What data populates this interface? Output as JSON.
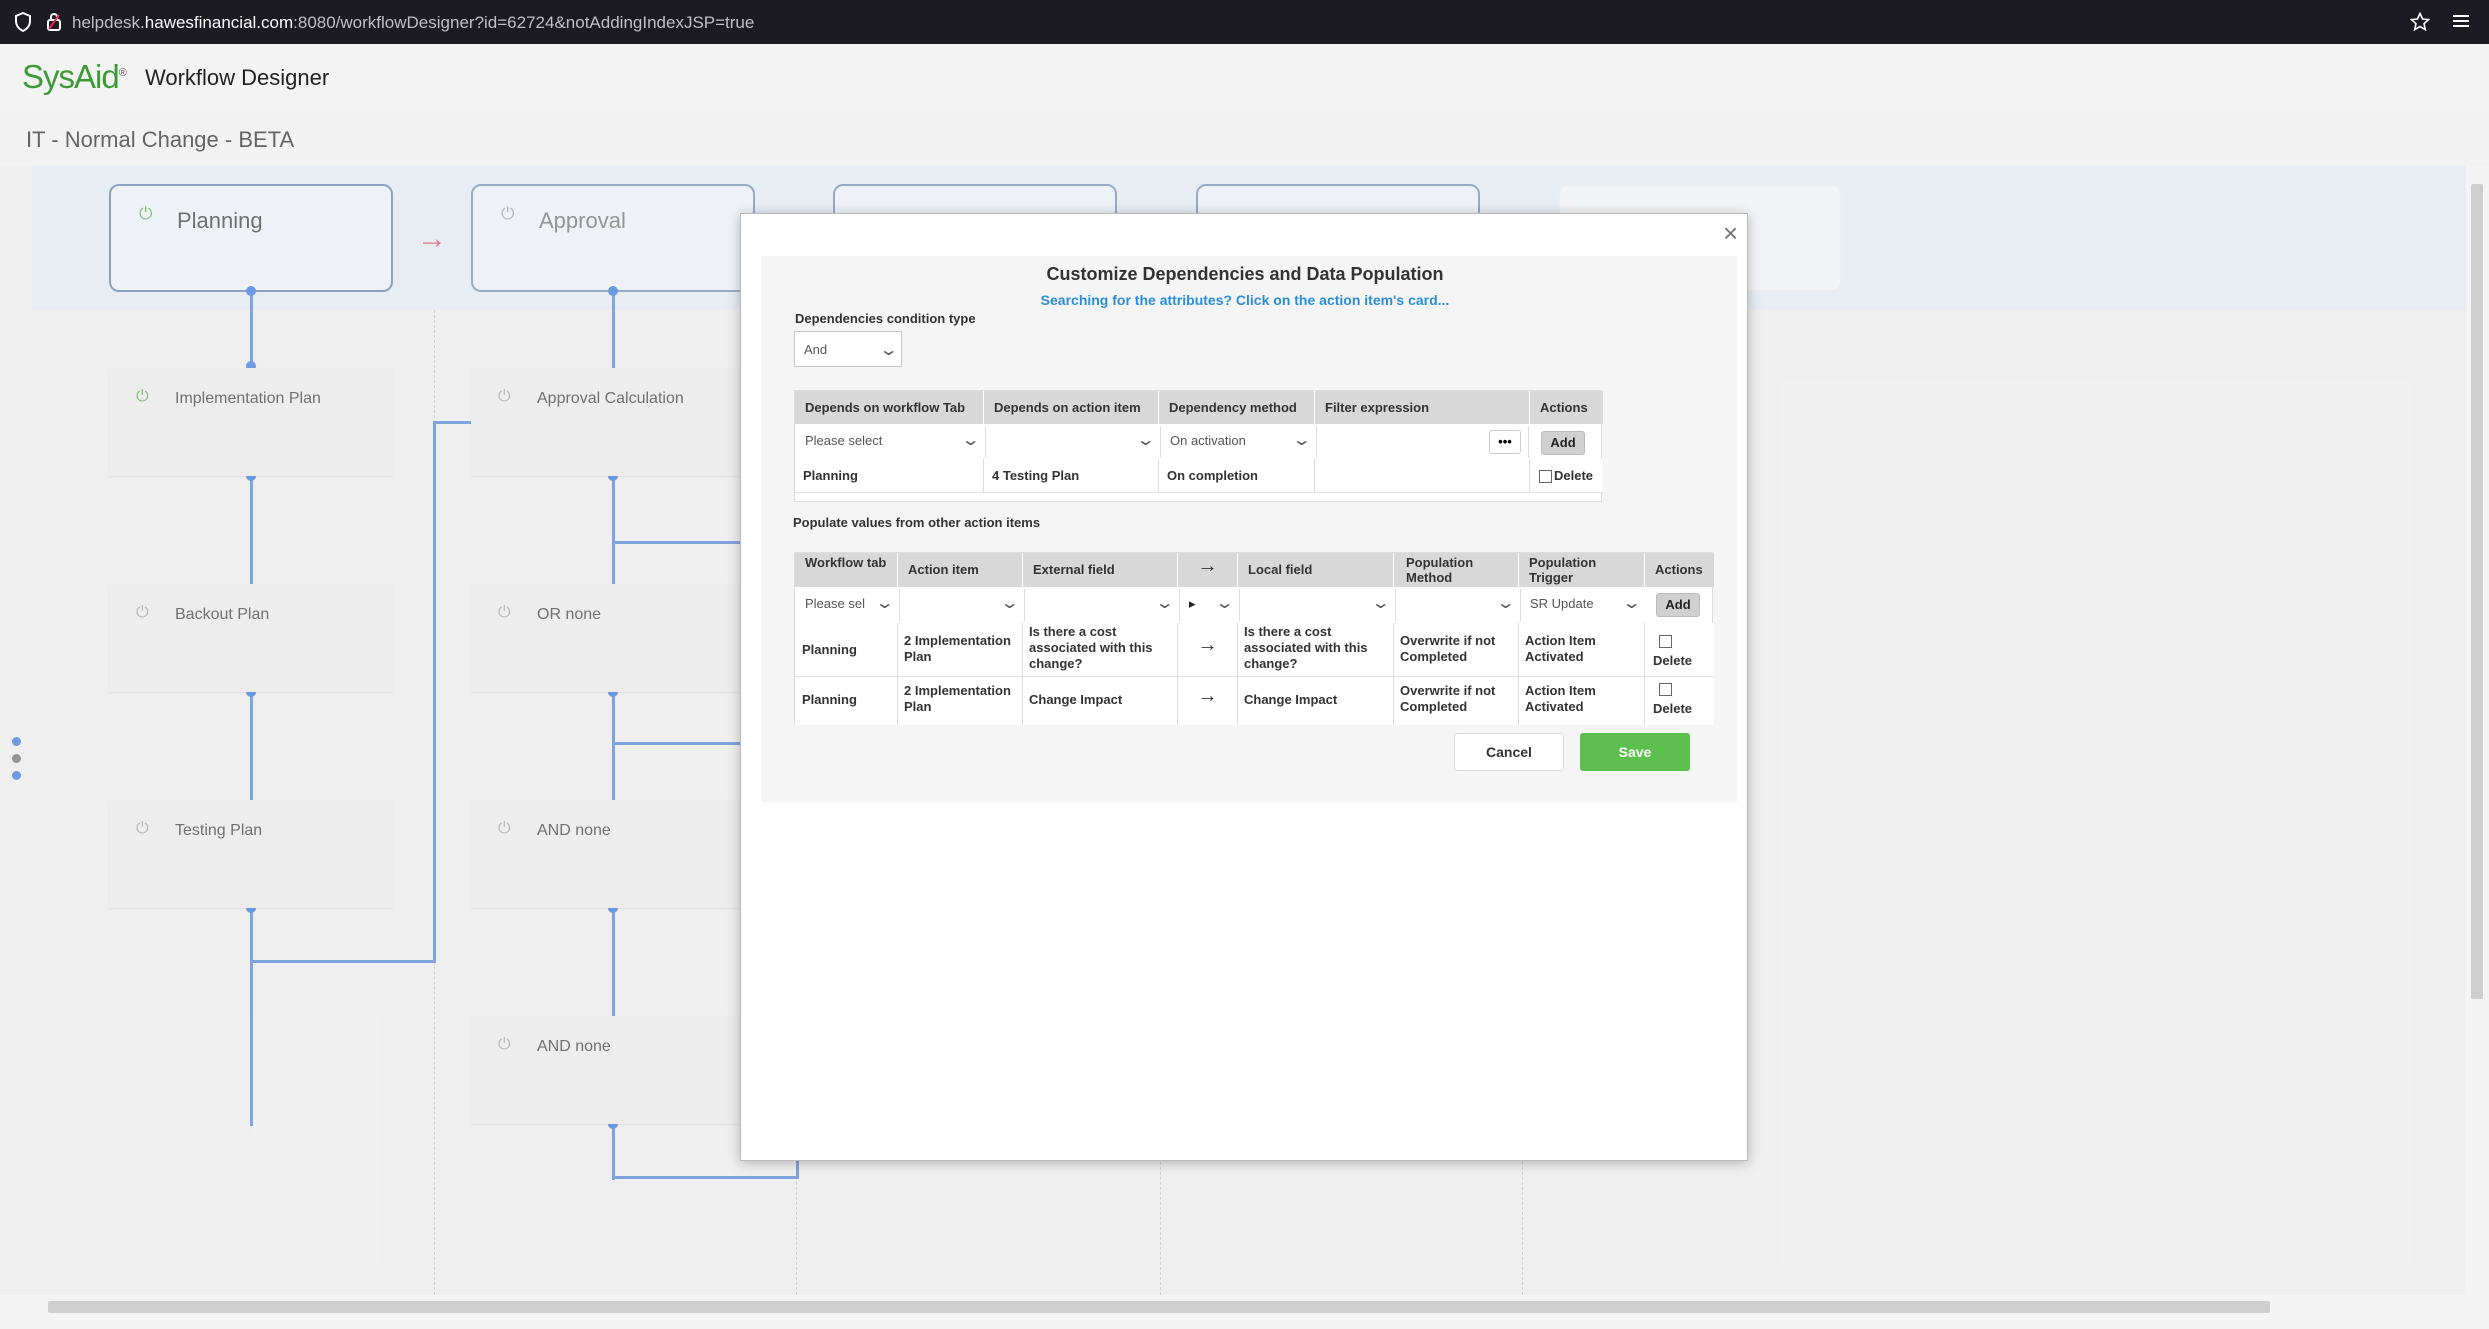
{
  "browser": {
    "url_prefix": "helpdesk.",
    "url_domain": "hawesfinancial.com",
    "url_suffix": ":8080/workflowDesigner?id=62724&notAddingIndexJSP=true",
    "shield_icon": "shield-icon",
    "lock_icon": "lock-icon",
    "star_icon": "star-icon",
    "menu_icon": "hamburger-menu-icon"
  },
  "app": {
    "logo_text": "SysAid",
    "logo_mark": "®",
    "title": "Workflow Designer",
    "workflow_name": "IT - Normal Change - BETA"
  },
  "workflow": {
    "tabs": [
      {
        "name": "Planning",
        "active": true
      },
      {
        "name": "Approval",
        "active": false
      },
      {
        "name": "",
        "active": false
      },
      {
        "name": "",
        "active": false
      },
      {
        "name": "",
        "active": false
      }
    ],
    "tab_arrow": "→",
    "planning_items": [
      "Implementation Plan",
      "Backout Plan",
      "Testing Plan"
    ],
    "approval_items": [
      "Approval Calculation",
      "OR none",
      "AND none",
      "AND none"
    ]
  },
  "modal": {
    "close": "×",
    "title": "Customize Dependencies and Data Population",
    "subtitle": "Searching for the attributes? Click on the action item's card...",
    "condition_label": "Dependencies condition type",
    "condition_value": "And",
    "dep_headers": [
      "Depends on workflow Tab",
      "Depends on action item",
      "Dependency method",
      "Filter expression",
      "Actions"
    ],
    "dep_input": {
      "tab": "Please select",
      "item": "",
      "method": "On activation",
      "more": "•••",
      "add": "Add"
    },
    "dep_rows": [
      {
        "tab": "Planning",
        "item": "4 Testing Plan",
        "method": "On completion",
        "filter": "",
        "delete": "Delete"
      }
    ],
    "pop_label": "Populate values from other action items",
    "pop_headers": [
      "Workflow tab",
      "Action item",
      "External field",
      "→",
      "Local field",
      "Population Method",
      "Population Trigger",
      "Actions"
    ],
    "pop_input": {
      "tab": "Please sel",
      "item": "",
      "ext": "",
      "dir": "▸",
      "local": "",
      "method": "",
      "trigger": "SR Update",
      "add": "Add"
    },
    "pop_rows": [
      {
        "tab": "Planning",
        "item": "2 Implementation Plan",
        "ext": "Is there a cost associated with this change?",
        "arrow": "→",
        "local": "Is there a cost associated with this change?",
        "method": "Overwrite if not Completed",
        "trigger": "Action Item Activated",
        "delete": "Delete"
      },
      {
        "tab": "Planning",
        "item": "2 Implementation Plan",
        "ext": "Change Impact",
        "arrow": "→",
        "local": "Change Impact",
        "method": "Overwrite if not Completed",
        "trigger": "Action Item Activated",
        "delete": "Delete"
      }
    ],
    "cancel": "Cancel",
    "save": "Save"
  }
}
